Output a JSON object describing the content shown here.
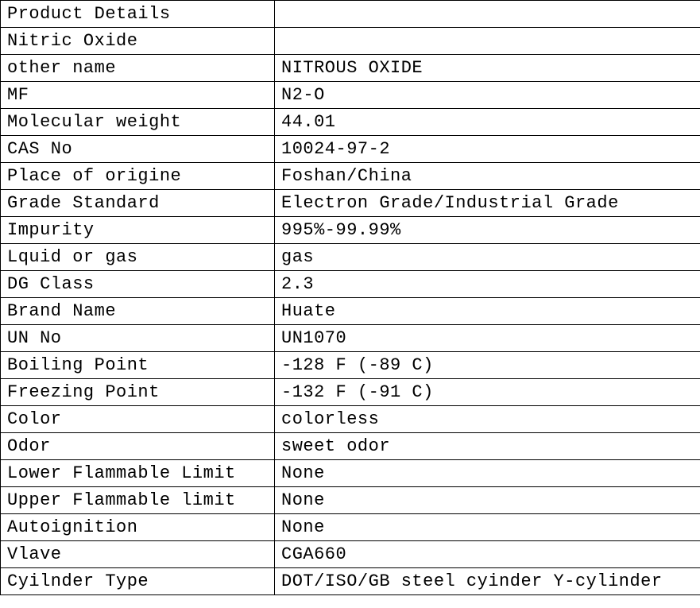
{
  "rows": [
    {
      "label": "Product Details",
      "value": ""
    },
    {
      "label": "Nitric Oxide",
      "value": ""
    },
    {
      "label": "other name",
      "value": " NITROUS OXIDE"
    },
    {
      "label": "MF",
      "value": "N2-O"
    },
    {
      "label": "Molecular weight",
      "value": "44.01"
    },
    {
      "label": "CAS No",
      "value": "10024-97-2"
    },
    {
      "label": "Place of origine",
      "value": "Foshan/China"
    },
    {
      "label": "Grade Standard",
      "value": "Electron Grade/Industrial Grade"
    },
    {
      "label": "Impurity",
      "value": "995%-99.99%"
    },
    {
      "label": "Lquid or gas",
      "value": "gas"
    },
    {
      "label": "DG Class",
      "value": "2.3"
    },
    {
      "label": "Brand Name",
      "value": "Huate"
    },
    {
      "label": "UN No",
      "value": " UN1070"
    },
    {
      "label": "Boiling Point",
      "value": "-128 F (-89 C)"
    },
    {
      "label": "Freezing Point",
      "value": " -132 F (-91 C)"
    },
    {
      "label": "Color",
      "value": " colorless"
    },
    {
      "label": "Odor",
      "value": "sweet odor"
    },
    {
      "label": "Lower Flammable Limit",
      "value": "None"
    },
    {
      "label": "Upper Flammable limit",
      "value": "None"
    },
    {
      "label": "Autoignition",
      "value": "None"
    },
    {
      "label": "Vlave",
      "value": "CGA660"
    },
    {
      "label": "Cyilnder Type",
      "value": "DOT/ISO/GB steel cyinder  Y-cylinder"
    }
  ]
}
